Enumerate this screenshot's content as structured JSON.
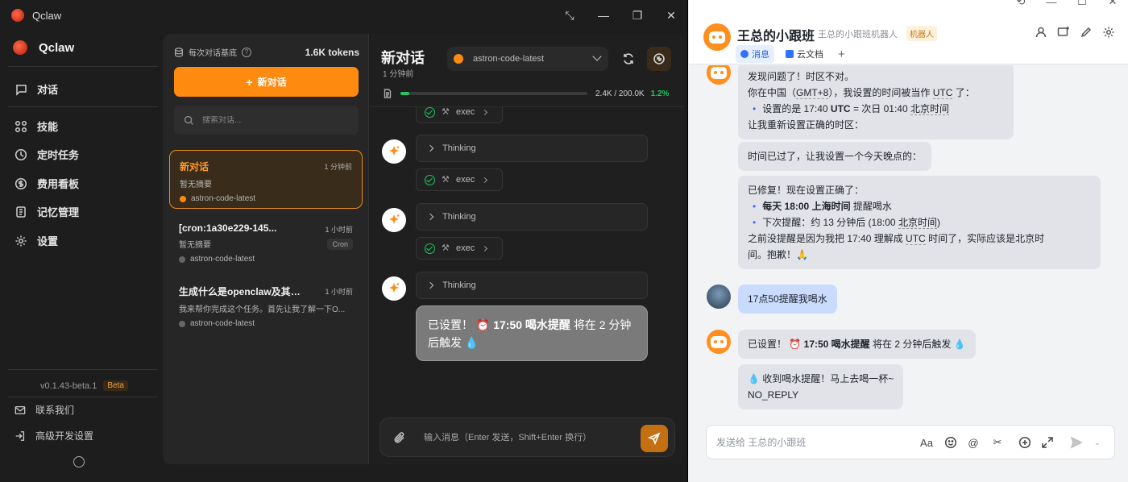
{
  "qclaw": {
    "window_title": "Qclaw",
    "brand": "Qclaw",
    "nav": [
      {
        "label": "对话",
        "icon": "chat-icon"
      },
      {
        "label": "技能",
        "icon": "grid-icon"
      },
      {
        "label": "定时任务",
        "icon": "clock-icon"
      },
      {
        "label": "费用看板",
        "icon": "dollar-icon"
      },
      {
        "label": "记忆管理",
        "icon": "memory-icon"
      },
      {
        "label": "设置",
        "icon": "gear-icon"
      }
    ],
    "version": "v0.1.43-beta.1",
    "version_badge": "Beta",
    "bottom": [
      {
        "label": "联系我们",
        "icon": "mail-icon"
      },
      {
        "label": "高级开发设置",
        "icon": "login-icon"
      }
    ],
    "conv_panel": {
      "per_conv_label": "每次对话基底",
      "tokens": "1.6K tokens",
      "new_button": "新对话",
      "search_placeholder": "搜索对话...",
      "conversations": [
        {
          "title": "新对话",
          "time": "1 分钟前",
          "summary": "暂无摘要",
          "model": "astron-code-latest",
          "tag": ""
        },
        {
          "title": "[cron:1a30e229-145...",
          "time": "1 小时前",
          "summary": "暂无摘要",
          "model": "astron-code-latest",
          "tag": "Cron"
        },
        {
          "title": "生成什么是openclaw及其原...",
          "time": "1 小时前",
          "summary": "我来帮你完成这个任务。首先让我了解一下O...",
          "model": "astron-code-latest",
          "tag": ""
        }
      ]
    },
    "chat": {
      "title": "新对话",
      "subtitle": "1 分钟前",
      "model": "astron-code-latest",
      "context_text": "2.4K / 200.0K",
      "context_pct": "1.2%",
      "context_fraction": 0.012,
      "thinking_label": "Thinking",
      "exec_label": "exec",
      "final_prefix": "已设置！",
      "final_bold": "17:50 喝水提醒",
      "final_suffix": "将在 2 分钟后触发",
      "input_placeholder": "输入消息（Enter 发送，Shift+Enter 换行）"
    },
    "colors": {
      "accent": "#ff8a10",
      "success": "#22c55e"
    }
  },
  "feishu": {
    "group_name": "王总的小跟班",
    "group_desc": "王总的小跟班机器人",
    "group_tag": "机器人",
    "tabs": [
      "消息",
      "云文档"
    ],
    "messages": {
      "m1_l1": "发现问题了！时区不对。",
      "m1_l2a": "你在中国（",
      "m1_l2b": "GMT+8",
      "m1_l2c": "），我设置的时间被当作",
      "m1_l2d": "UTC",
      "m1_l2e": "了：",
      "m1_l3a": "设置的是 17:40",
      "m1_l3b": "UTC",
      "m1_l3c": "= 次日 01:40",
      "m1_l3d": "北京时间",
      "m1_l4": "让我重新设置正确的时区：",
      "m2": "时间已过了，让我设置一个今天晚点的：",
      "m3_l1": "已修复！现在设置正确了：",
      "m3_l2a": "每天 18:00 上海时间",
      "m3_l2b": "提醒喝水",
      "m3_l3a": "下次提醒：约 13 分钟后 (18:00",
      "m3_l3b": "北京时间",
      "m3_l3c": ")",
      "m3_l4a": "之前没提醒是因为我把 17:40 理解成",
      "m3_l4b": "UTC",
      "m3_l4c": "时间了，实际应该是北京时",
      "m3_l5": "间。抱歉！🙏",
      "user_msg": "17点50提醒我喝水",
      "m4_a": "已设置！",
      "m4_b": "17:50 喝水提醒",
      "m4_c": "将在 2 分钟后触发",
      "m5_l1": "收到喝水提醒！马上去喝一杯~",
      "m5_l2": "NO_REPLY"
    },
    "input_placeholder": "发送给 王总的小跟班"
  }
}
